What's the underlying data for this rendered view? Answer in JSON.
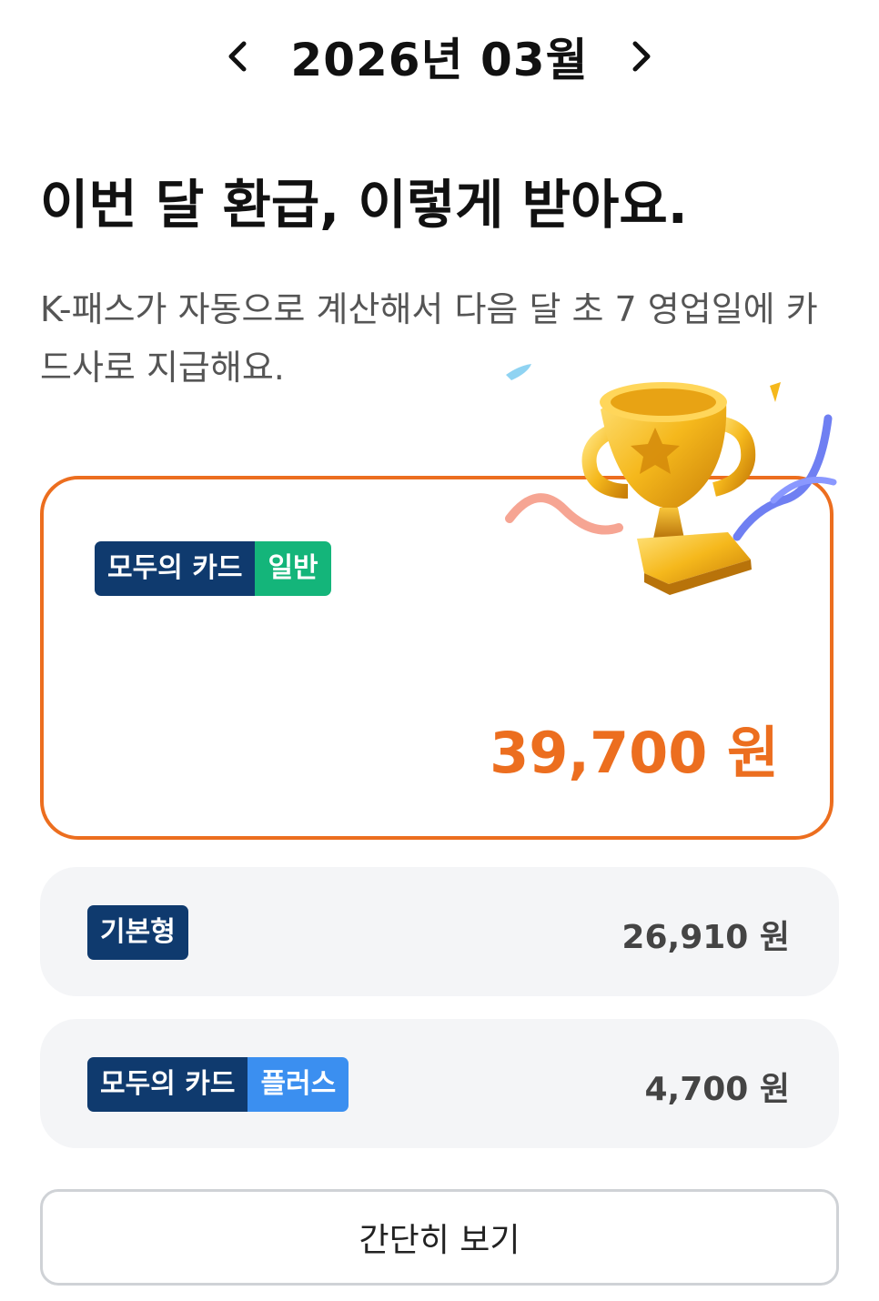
{
  "month_nav": {
    "prev_icon": "chevron-left-icon",
    "label": "2026년 03월",
    "next_icon": "chevron-right-icon"
  },
  "headline": "이번 달 환급, 이렇게 받아요.",
  "subtext": "K-패스가 자동으로 계산해서 다음 달 초 7 영업일에 카드사로 지급해요.",
  "illustration": "trophy-confetti-icon",
  "main_card": {
    "tag_main": "모두의 카드",
    "tag_sub": "일반",
    "amount": "39,700 원"
  },
  "rows": [
    {
      "tag_main": "기본형",
      "tag_sub": "",
      "amount": "26,910 원"
    },
    {
      "tag_main": "모두의 카드",
      "tag_sub": "플러스",
      "amount": "4,700 원"
    }
  ],
  "summary_button": "간단히 보기",
  "colors": {
    "accent": "#ec6e1f",
    "navy": "#0f3a6e",
    "green": "#14b57a",
    "blue": "#3b8ff0",
    "row_bg": "#f4f5f7"
  }
}
